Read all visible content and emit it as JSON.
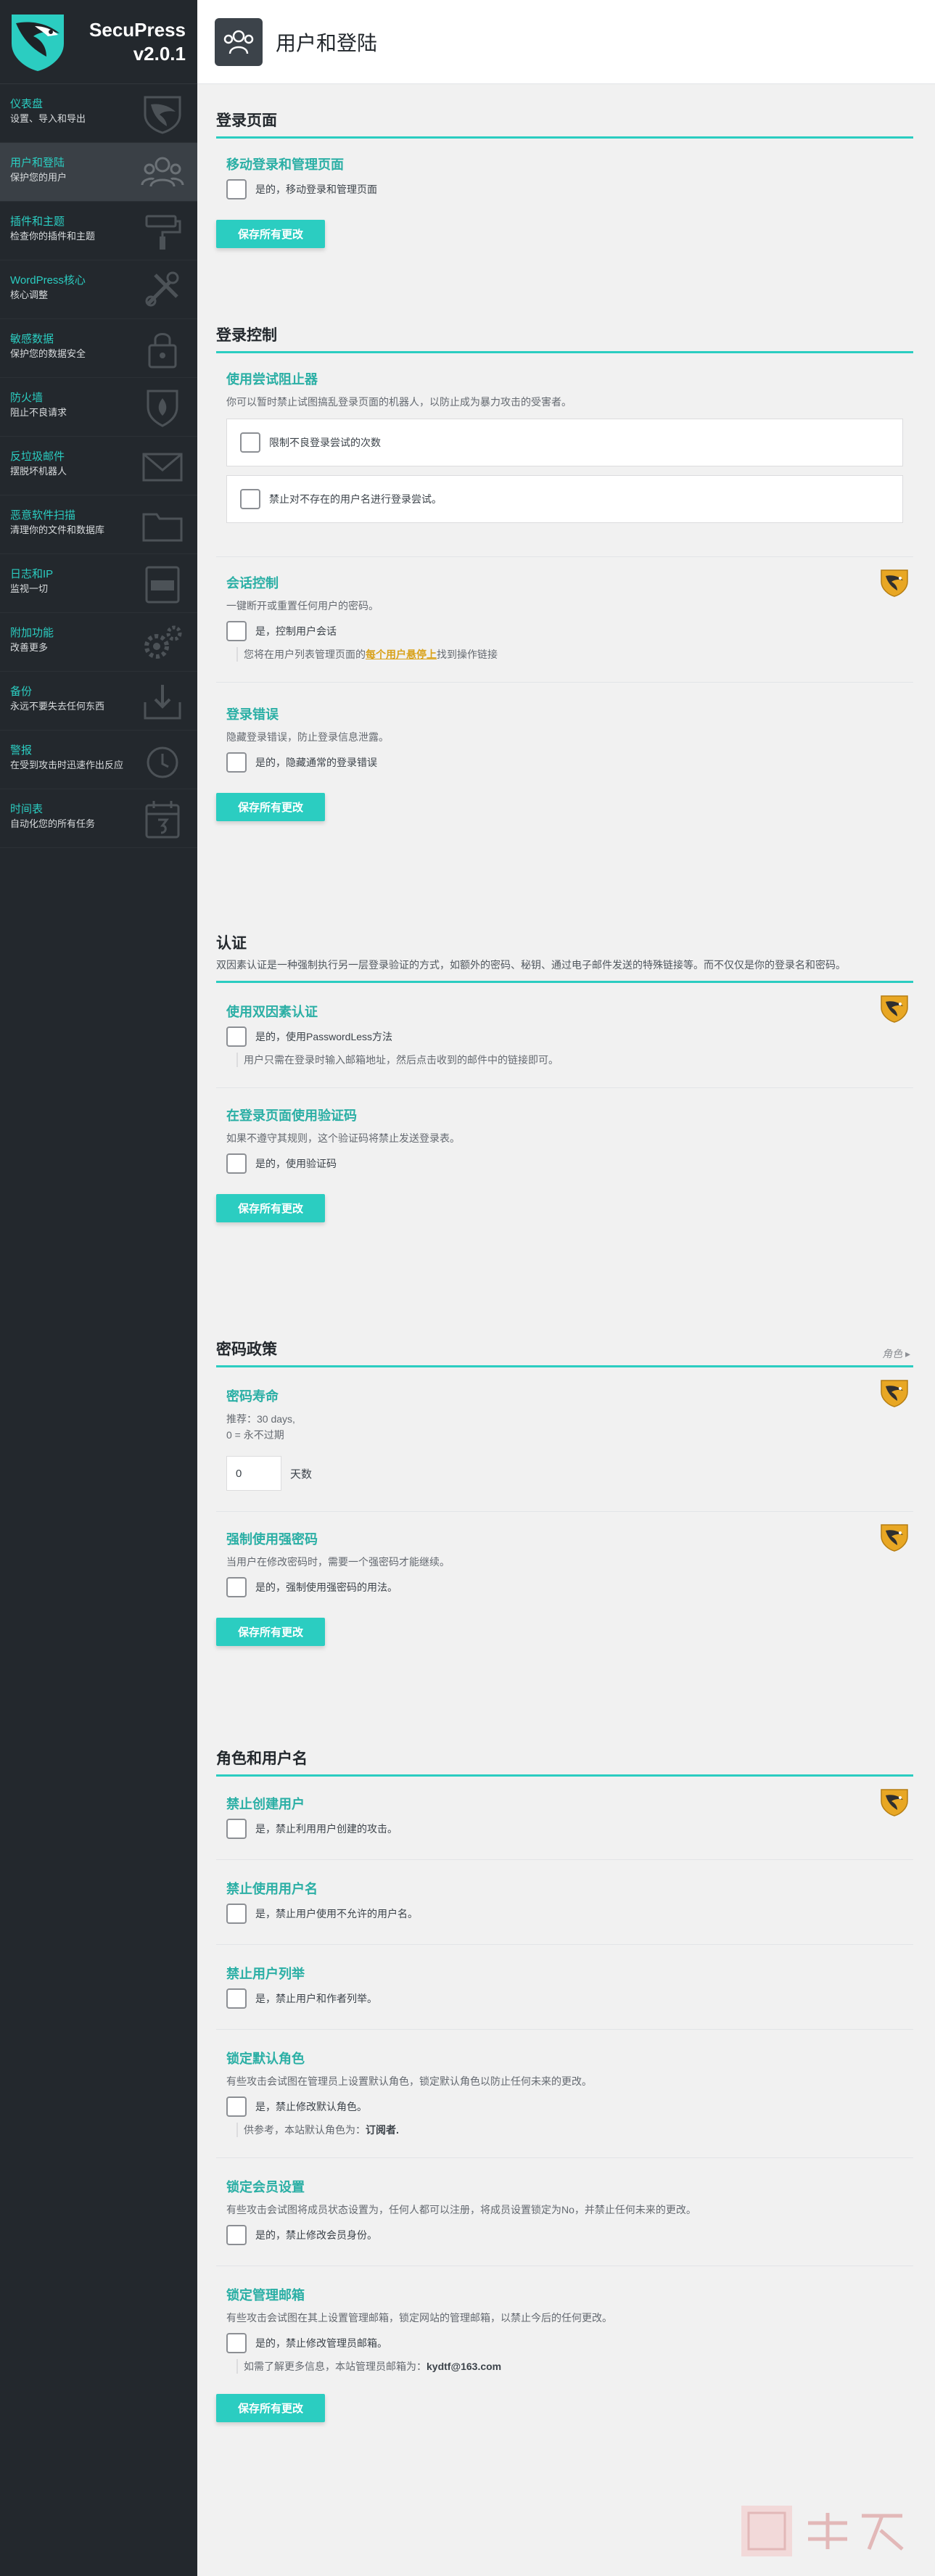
{
  "brand": {
    "name": "SecuPress",
    "version": "v2.0.1"
  },
  "sidebar": {
    "items": [
      {
        "title": "仪表盘",
        "desc": "设置、导入和导出",
        "icon": "shield-icon"
      },
      {
        "title": "用户和登陆",
        "desc": "保护您的用户",
        "icon": "users-icon",
        "active": true
      },
      {
        "title": "插件和主题",
        "desc": "检查你的插件和主题",
        "icon": "paint-roller-icon"
      },
      {
        "title": "WordPress核心",
        "desc": "核心调整",
        "icon": "tools-icon"
      },
      {
        "title": "敏感数据",
        "desc": "保护您的数据安全",
        "icon": "lock-icon"
      },
      {
        "title": "防火墙",
        "desc": "阻止不良请求",
        "icon": "firewall-icon"
      },
      {
        "title": "反垃圾邮件",
        "desc": "摆脱坏机器人",
        "icon": "envelope-icon"
      },
      {
        "title": "恶意软件扫描",
        "desc": "清理你的文件和数据库",
        "icon": "folder-icon"
      },
      {
        "title": "日志和IP",
        "desc": "监视一切",
        "icon": "log-icon"
      },
      {
        "title": "附加功能",
        "desc": "改善更多",
        "icon": "gears-icon"
      },
      {
        "title": "备份",
        "desc": "永远不要失去任何东西",
        "icon": "backup-icon"
      },
      {
        "title": "警报",
        "desc": "在受到攻击时迅速作出反应",
        "icon": "alarm-icon"
      },
      {
        "title": "时间表",
        "desc": "自动化您的所有任务",
        "icon": "calendar-icon"
      }
    ]
  },
  "header": {
    "title": "用户和登陆"
  },
  "save_label": "保存所有更改",
  "sections": {
    "login_page": {
      "title": "登录页面",
      "move": {
        "title": "移动登录和管理页面",
        "check": "是的，移动登录和管理页面"
      }
    },
    "login_control": {
      "title": "登录控制",
      "limit": {
        "title": "使用尝试阻止器",
        "desc": "你可以暂时禁止试图搞乱登录页面的机器人，以防止成为暴力攻击的受害者。",
        "opt1": "限制不良登录尝试的次数",
        "opt2": "禁止对不存在的用户名进行登录尝试。"
      },
      "session": {
        "title": "会话控制",
        "desc": "一键断开或重置任何用户的密码。",
        "check": "是，控制用户会话",
        "note_pre": "您将在用户列表管理页面的",
        "note_link": "每个用户悬停上",
        "note_post": "找到操作链接"
      },
      "errors": {
        "title": "登录错误",
        "desc": "隐藏登录错误，防止登录信息泄露。",
        "check": "是的，隐藏通常的登录错误"
      }
    },
    "auth": {
      "title": "认证",
      "desc": "双因素认证是一种强制执行另一层登录验证的方式，如额外的密码、秘钥、通过电子邮件发送的特殊链接等。而不仅仅是你的登录名和密码。",
      "twofa": {
        "title": "使用双因素认证",
        "check": "是的，使用PasswordLess方法",
        "note": "用户只需在登录时输入邮箱地址，然后点击收到的邮件中的链接即可。"
      },
      "captcha": {
        "title": "在登录页面使用验证码",
        "desc": "如果不遵守其规则，这个验证码将禁止发送登录表。",
        "check": "是的，使用验证码"
      }
    },
    "password": {
      "title": "密码政策",
      "roles_link": "角色",
      "lifespan": {
        "title": "密码寿命",
        "desc_line1": "推荐：30 days,",
        "desc_line2": "0 = 永不过期",
        "value": "0",
        "unit": "天数"
      },
      "strong": {
        "title": "强制使用强密码",
        "desc": "当用户在修改密码时，需要一个强密码才能继续。",
        "check": "是的，强制使用强密码的用法。"
      }
    },
    "roles": {
      "title": "角色和用户名",
      "block_create": {
        "title": "禁止创建用户",
        "check": "是，禁止利用用户创建的攻击。"
      },
      "block_names": {
        "title": "禁止使用用户名",
        "check": "是，禁止用户使用不允许的用户名。"
      },
      "block_list": {
        "title": "禁止用户列举",
        "check": "是，禁止用户和作者列举。"
      },
      "lock_role": {
        "title": "锁定默认角色",
        "desc": "有些攻击会试图在管理员上设置默认角色，锁定默认角色以防止任何未来的更改。",
        "check": "是，禁止修改默认角色。",
        "note_pre": "供参考，本站默认角色为：",
        "note_value": "订阅者."
      },
      "lock_membership": {
        "title": "锁定会员设置",
        "desc": "有些攻击会试图将成员状态设置为，任何人都可以注册，将成员设置锁定为No，并禁止任何未来的更改。",
        "check": "是的，禁止修改会员身份。"
      },
      "lock_email": {
        "title": "锁定管理邮箱",
        "desc": "有些攻击会试图在其上设置管理邮箱，锁定网站的管理邮箱，以禁止今后的任何更改。",
        "check": "是的，禁止修改管理员邮箱。",
        "note_pre": "如需了解更多信息，本站管理员邮箱为：",
        "note_value": "kydtf@163.com"
      }
    }
  },
  "colors": {
    "accent": "#2bcdc1",
    "sidebar_bg": "#23282d",
    "link_gold": "#d9a21b"
  }
}
